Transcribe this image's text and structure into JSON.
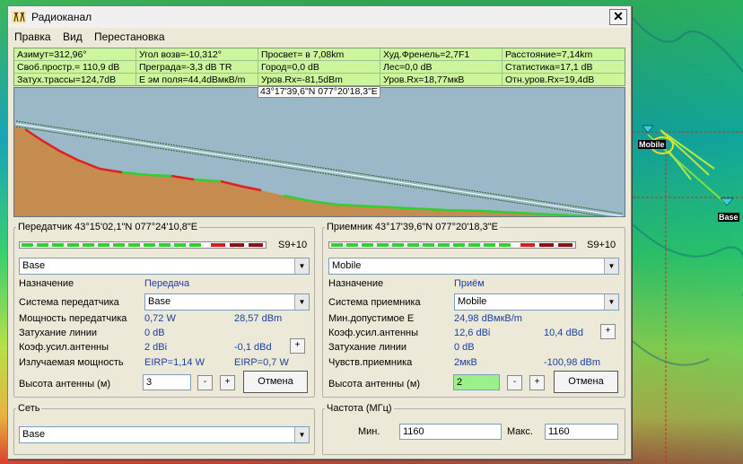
{
  "window": {
    "title": "Радиоканал",
    "close_label": "✕"
  },
  "menu": [
    "Правка",
    "Вид",
    "Перестановка"
  ],
  "info": {
    "row1": [
      "Азимут=312,96°",
      "Угол возв=-10,312°",
      "Просвет= в 7,08km",
      "Худ.Френель=2,7F1",
      "Расстояние=7,14km"
    ],
    "row2": [
      "Своб.простр.= 110,9 dB",
      "Преграда=-3,3 dB TR",
      "Город=0,0 dB",
      "Лес=0,0 dB",
      "Статистика=17,1 dB"
    ],
    "row3": [
      "Затух.трассы=124,7dB",
      "E эм поля=44,4dBмкВ/m",
      "Уров.Rx=-81,5dBm",
      "Уров.Rx=18,77мкВ",
      "Отн.уров.Rx=19,4dB"
    ]
  },
  "coord_tooltip": "43°17'39,6\"N 077°20'18,3\"E",
  "transmitter": {
    "legend": "Передатчик 43°15'02,1\"N 077°24'10,8\"E",
    "signal_label": "S9+10",
    "station": "Base",
    "purpose_label": "Назначение",
    "purpose_value": "Передача",
    "system_label": "Система передатчика",
    "system_value": "Base",
    "power_label": "Мощность передатчика",
    "power_w": "0,72 W",
    "power_dbm": "28,57 dBm",
    "loss_label": "Затухание линии",
    "loss_value": "0 dB",
    "gain_label": "Коэф.усил.антенны",
    "gain_dbi": "2 dBi",
    "gain_dbd": "-0,1 dBd",
    "gain_btn": "+",
    "radiated_label": "Излучаемая мощность",
    "eirp": "EIRP=1,14 W",
    "erp": "EIRP=0,7 W",
    "height_label": "Высота антенны (м)",
    "height_value": "3",
    "minus": "-",
    "plus": "+",
    "cancel": "Отмена"
  },
  "receiver": {
    "legend": "Приемник 43°17'39,6\"N 077°20'18,3\"E",
    "signal_label": "S9+10",
    "station": "Mobile",
    "purpose_label": "Назначение",
    "purpose_value": "Приём",
    "system_label": "Система приемника",
    "system_value": "Mobile",
    "min_label": "Мин.допустимое E",
    "min_value": "24,98 dBмкВ/m",
    "gain_label": "Коэф.усил.антенны",
    "gain_dbi": "12,6 dBi",
    "gain_dbd": "10,4 dBd",
    "gain_btn": "+",
    "loss_label": "Затухание линии",
    "loss_value": "0 dB",
    "sens_label": "Чувств.приемника",
    "sens_uv": "2мкВ",
    "sens_dbm": "-100,98 dBm",
    "height_label": "Высота антенны (м)",
    "height_value": "2",
    "minus": "-",
    "plus": "+",
    "cancel": "Отмена"
  },
  "network": {
    "legend": "Сеть",
    "value": "Base"
  },
  "frequency": {
    "legend": "Частота (МГц)",
    "min_label": "Мин.",
    "min_value": "1160",
    "max_label": "Макс.",
    "max_value": "1160"
  },
  "map": {
    "mobile_label": "Mobile",
    "base_label": "Base"
  },
  "colors": {
    "info_bg": "#ccf59c",
    "sky": "#9ab8c7",
    "terrain": "#c68b4e",
    "obstruct": "#e02020",
    "clear": "#2fd02f"
  }
}
